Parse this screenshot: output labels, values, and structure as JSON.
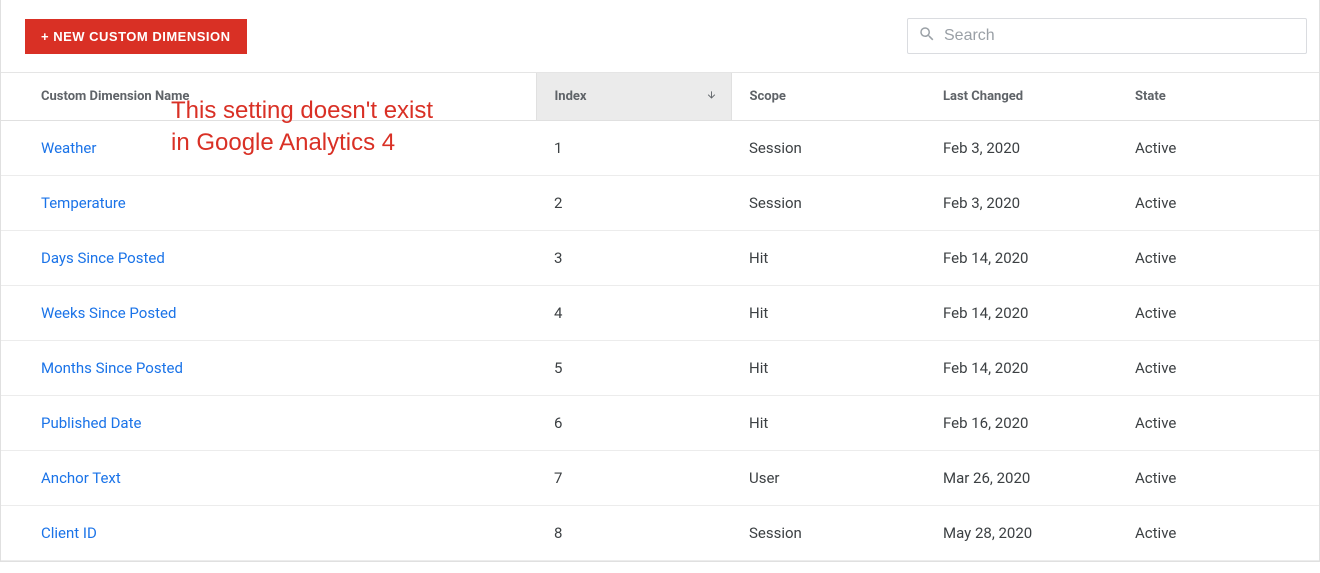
{
  "toolbar": {
    "new_button_label": "+ NEW CUSTOM DIMENSION",
    "search_placeholder": "Search"
  },
  "columns": {
    "name": "Custom Dimension Name",
    "index": "Index",
    "scope": "Scope",
    "last_changed": "Last Changed",
    "state": "State"
  },
  "rows": [
    {
      "name": "Weather",
      "index": "1",
      "scope": "Session",
      "last_changed": "Feb 3, 2020",
      "state": "Active"
    },
    {
      "name": "Temperature",
      "index": "2",
      "scope": "Session",
      "last_changed": "Feb 3, 2020",
      "state": "Active"
    },
    {
      "name": "Days Since Posted",
      "index": "3",
      "scope": "Hit",
      "last_changed": "Feb 14, 2020",
      "state": "Active"
    },
    {
      "name": "Weeks Since Posted",
      "index": "4",
      "scope": "Hit",
      "last_changed": "Feb 14, 2020",
      "state": "Active"
    },
    {
      "name": "Months Since Posted",
      "index": "5",
      "scope": "Hit",
      "last_changed": "Feb 14, 2020",
      "state": "Active"
    },
    {
      "name": "Published Date",
      "index": "6",
      "scope": "Hit",
      "last_changed": "Feb 16, 2020",
      "state": "Active"
    },
    {
      "name": "Anchor Text",
      "index": "7",
      "scope": "User",
      "last_changed": "Mar 26, 2020",
      "state": "Active"
    },
    {
      "name": "Client ID",
      "index": "8",
      "scope": "Session",
      "last_changed": "May 28, 2020",
      "state": "Active"
    }
  ],
  "annotation": {
    "line1": "This setting doesn't exist",
    "line2": "in Google Analytics 4"
  }
}
